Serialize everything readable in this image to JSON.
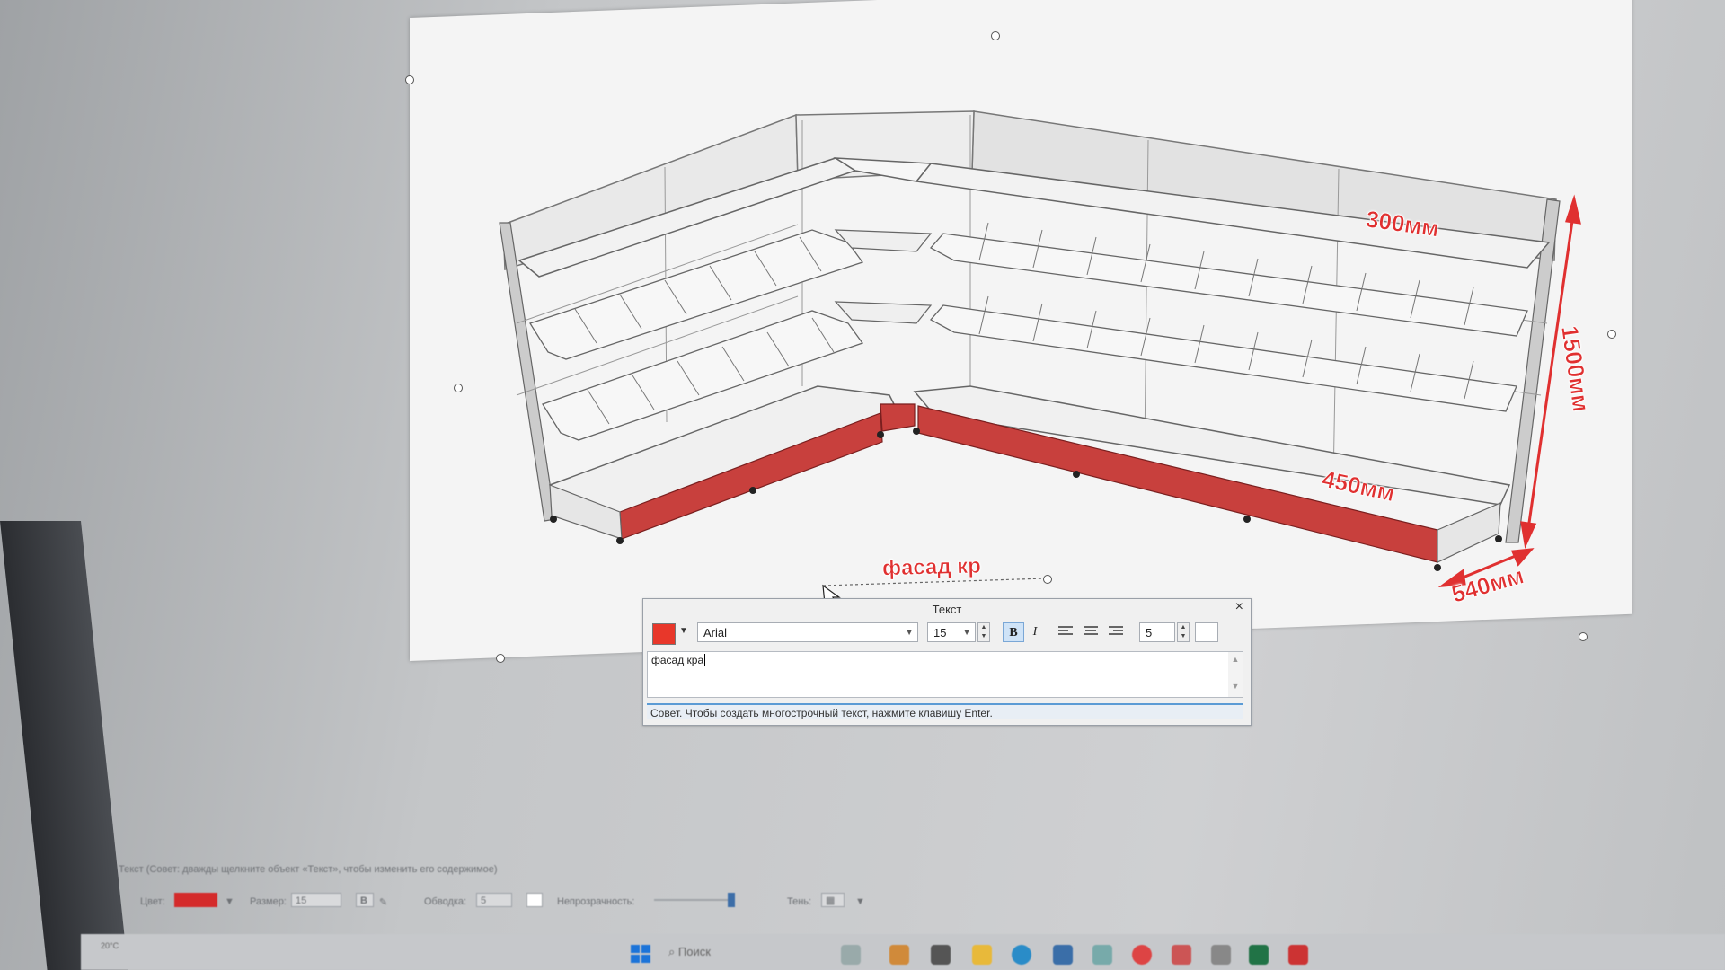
{
  "drawing": {
    "dimensions": {
      "top_shelf_depth": "300мм",
      "height": "1500мм",
      "bottom_shelf_depth": "450мм",
      "base_depth": "540мм"
    },
    "canvas_text": "фасад кр"
  },
  "text_dialog": {
    "title": "Текст",
    "close": "×",
    "color": "#e8372a",
    "font": "Arial",
    "size": "15",
    "bold": "B",
    "italic": "I",
    "outline_value": "5",
    "content": "фасад кра",
    "hint": "Совет. Чтобы создать многострочный текст, нажмите клавишу Enter."
  },
  "property_bar": {
    "hint": "Текст (Совет: дважды щелкните объект «Текст», чтобы изменить его содержимое)",
    "color_label": "Цвет:",
    "color": "#d42b2b",
    "size_label": "Размер:",
    "size": "15",
    "bold": "B",
    "outline_label": "Обводка:",
    "outline": "5",
    "opacity_label": "Непрозрачность:",
    "shadow_label": "Тень:"
  },
  "taskbar": {
    "search_placeholder": "Поиск",
    "weather": "20°C"
  }
}
